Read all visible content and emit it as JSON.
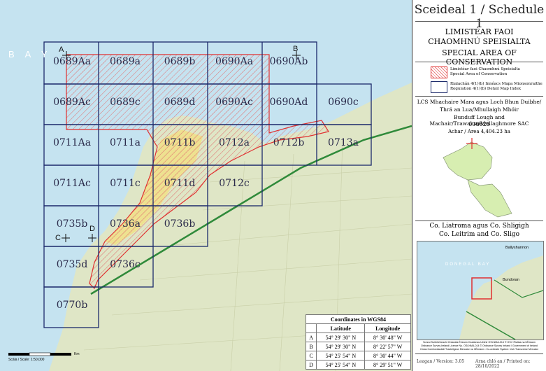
{
  "map": {
    "bay_label": "B A Y",
    "scale_label": "Scála / Scale: 1:50,000",
    "scale_unit": "Km",
    "tiles": [
      {
        "id": "0689Aa"
      },
      {
        "id": "0689a"
      },
      {
        "id": "0689b"
      },
      {
        "id": "0690Aa"
      },
      {
        "id": "0690Ab"
      },
      {
        "id": "0689Ac"
      },
      {
        "id": "0689c"
      },
      {
        "id": "0689d"
      },
      {
        "id": "0690Ac"
      },
      {
        "id": "0690Ad"
      },
      {
        "id": "0690c"
      },
      {
        "id": "0711Aa"
      },
      {
        "id": "0711a"
      },
      {
        "id": "0711b"
      },
      {
        "id": "0712a"
      },
      {
        "id": "0712b"
      },
      {
        "id": "0713a"
      },
      {
        "id": "0711Ac"
      },
      {
        "id": "0711c"
      },
      {
        "id": "0711d"
      },
      {
        "id": "0712c"
      },
      {
        "id": "0735b"
      },
      {
        "id": "0736a"
      },
      {
        "id": "0736b"
      },
      {
        "id": "0735d"
      },
      {
        "id": "0736c"
      },
      {
        "id": "0770b"
      }
    ],
    "points": [
      "A",
      "B",
      "C",
      "D"
    ]
  },
  "coords": {
    "title": "Coordinates in WGS84",
    "headers": [
      "",
      "Latitude",
      "Longitude"
    ],
    "rows": [
      [
        "A",
        "54° 29' 30\" N",
        "8° 30' 48\" W"
      ],
      [
        "B",
        "54° 29' 30\" N",
        "8° 22' 57\" W"
      ],
      [
        "C",
        "54° 25' 54\" N",
        "8° 30' 44\" W"
      ],
      [
        "D",
        "54° 25' 54\" N",
        "8° 29' 51\" W"
      ]
    ]
  },
  "panel": {
    "title": "Sceideal 1 / Schedule 1",
    "heading_ga1": "LIMISTÉAR FAOI",
    "heading_ga2": "CHAOMHNÚ SPEISIALTA",
    "heading_en": "SPECIAL AREA OF CONSERVATION",
    "legend_sac_ga": "Limistéar faoi Chaomhnú Speisialta",
    "legend_sac_en": "Special Area of Conservation",
    "legend_grid_ga": "Rialachán 4(1)(b) Innéacs Mapa Mionsonraithe",
    "legend_grid_en": "Regulation 4(1)(b) Detail Map Index",
    "site_line1": "LCS Mhachaire Mara agus Loch Bhun Duibhe/",
    "site_line2": "Thrá an Lua/Mhullaigh Mhóir",
    "site_line3": "Bunduff Lough and Machair/Trawalua/Mullaghmore SAC",
    "site_code": "000625",
    "area": "Achar / Area 4,404.23 ha",
    "county_ga": "Co. Liatroma agus Co. Shligigh",
    "county_en": "Co. Leitrim and Co. Sligo",
    "inset_bay": "DONEGAL BAY",
    "inset_town1": "Ballyshannon",
    "inset_town2": "Bundoran",
    "credits1": "Sonraí Suirbhéireacht Ordanáis Éireann Ceadúnas Uimhir OSi-NMA-014 © OSi / Rialtas na hÉireann",
    "credits2": "Ordnance Survey Ireland Licence No. OSi-NMA-014 © Ordnance Survey Ireland / Government of Ireland",
    "credits3": "Córas Comhordanáidí Trasteilgean Mercator na hÉireann • Co-ordinate System: Irish Transverse Mercator",
    "version": "Leagan / Version: 3.05",
    "printed": "Arna chló an / Printed on: 28/10/2022"
  },
  "colors": {
    "sac_red": "#e03030",
    "grid_navy": "#1c2a6b",
    "sea": "#c5e3f0"
  }
}
